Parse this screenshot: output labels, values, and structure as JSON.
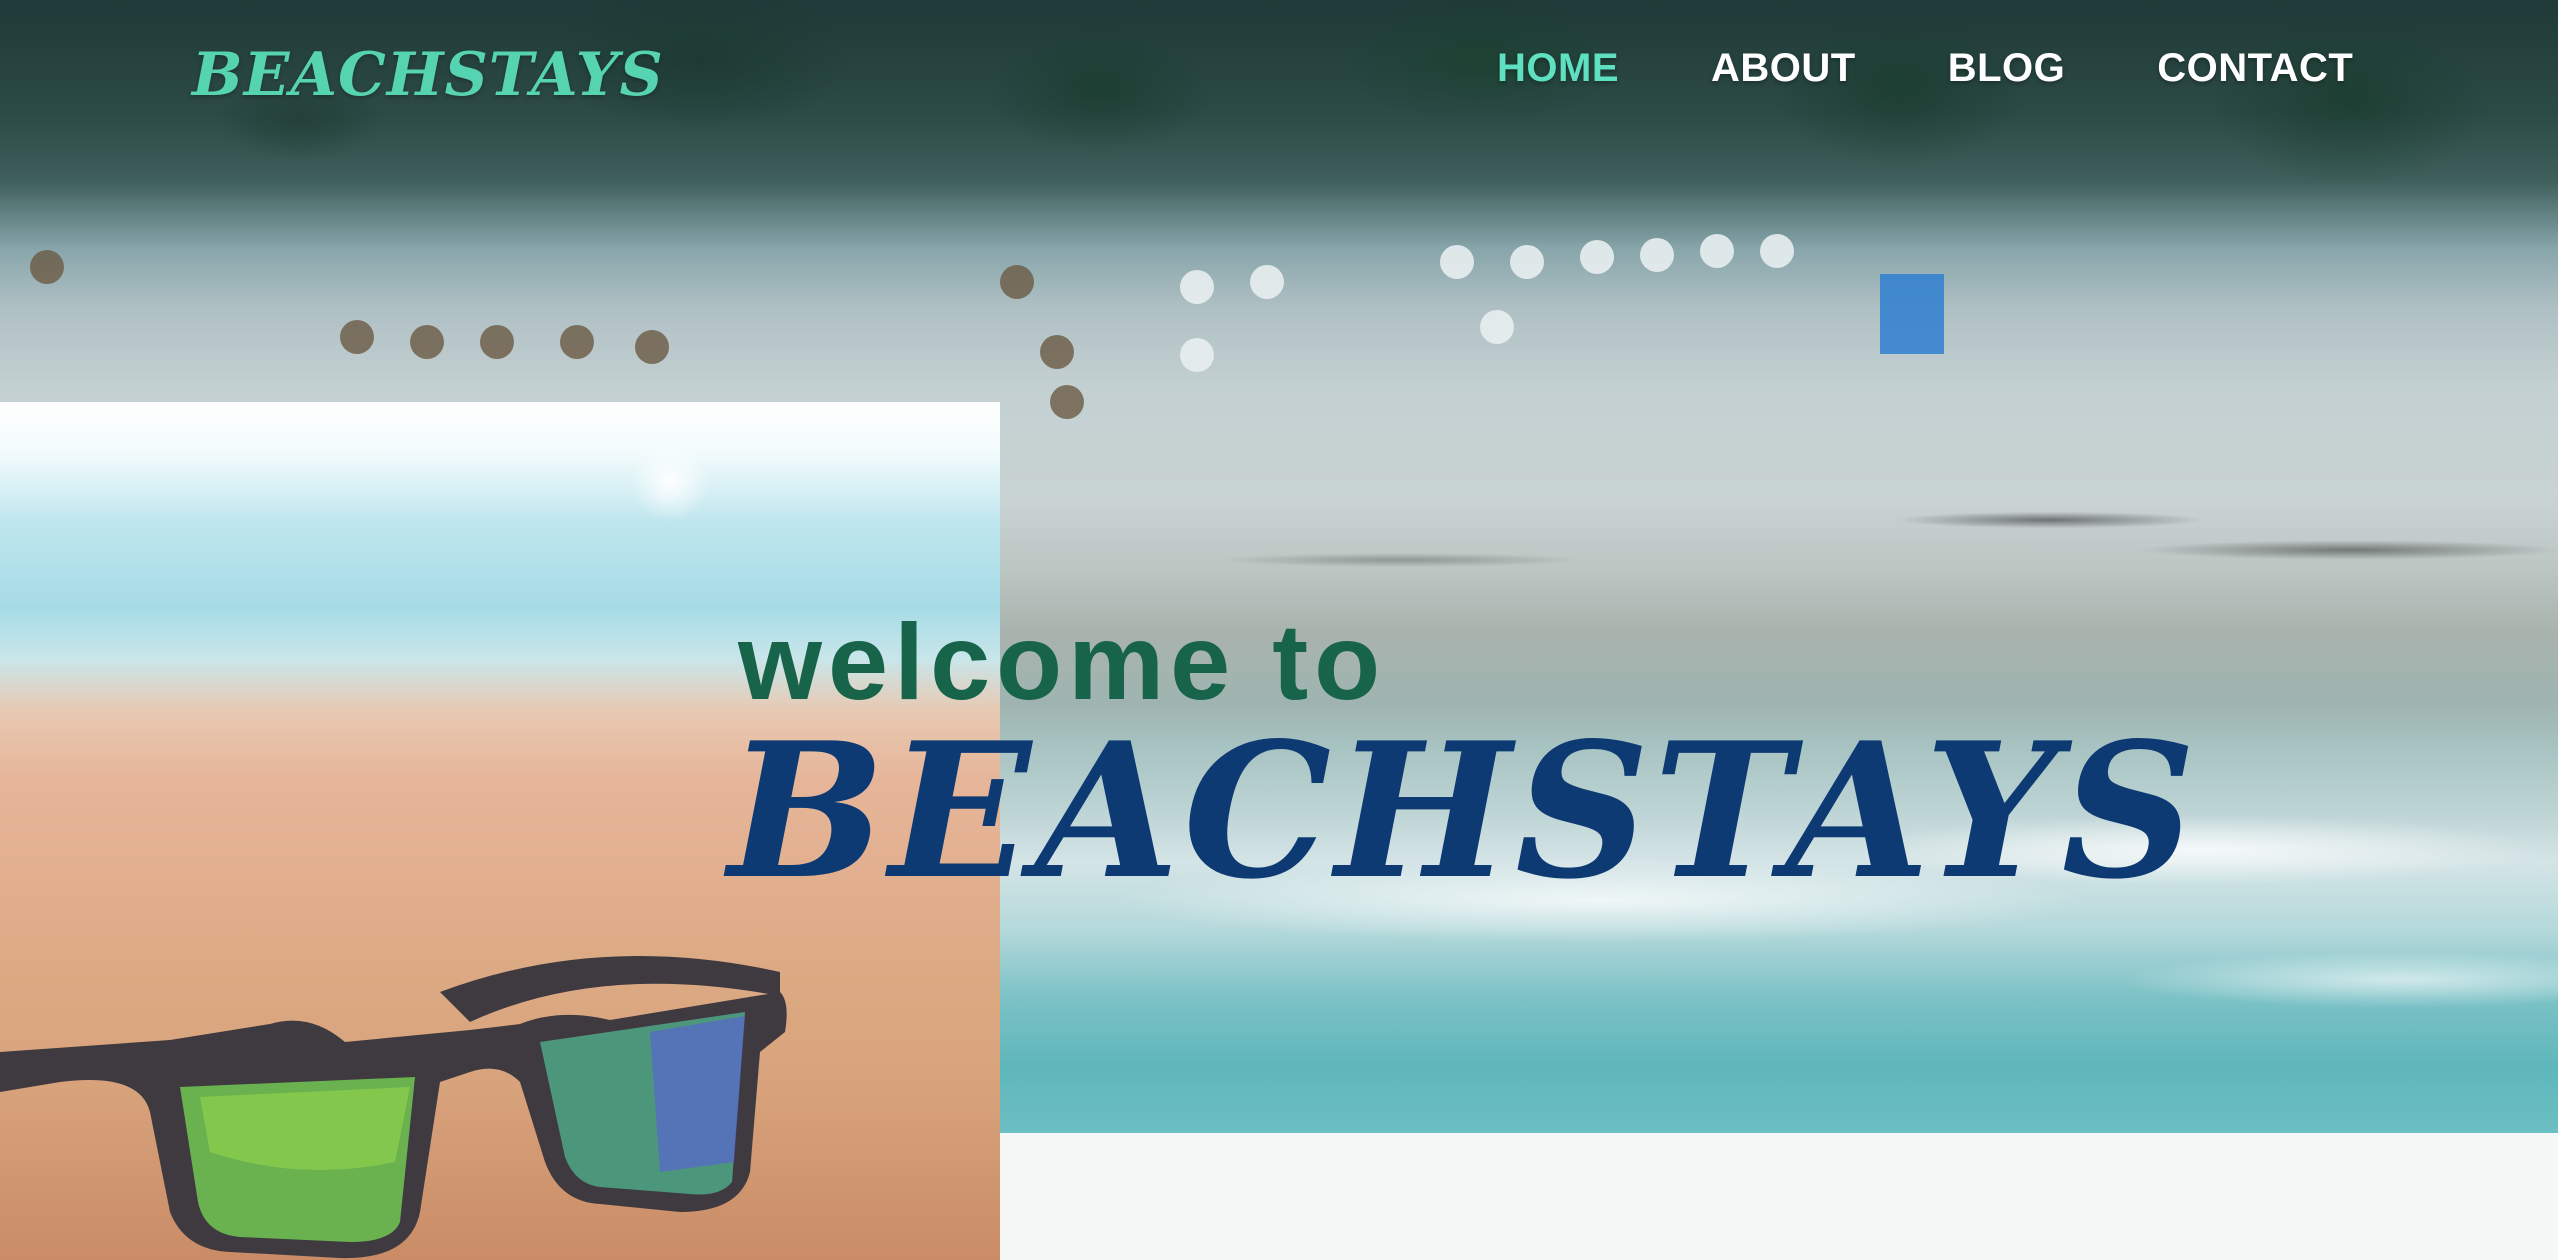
{
  "header": {
    "logo": "BEACHSTAYS",
    "nav": [
      {
        "label": "HOME",
        "active": true
      },
      {
        "label": "ABOUT",
        "active": false
      },
      {
        "label": "BLOG",
        "active": false
      },
      {
        "label": "CONTACT",
        "active": false
      }
    ]
  },
  "hero": {
    "welcome": "welcome to",
    "title": "BEACHSTAYS"
  },
  "colors": {
    "logo": "#56d3b0",
    "nav_active": "#5fe0c0",
    "nav": "#ffffff",
    "welcome": "#17644a",
    "title": "#0e3a73"
  }
}
